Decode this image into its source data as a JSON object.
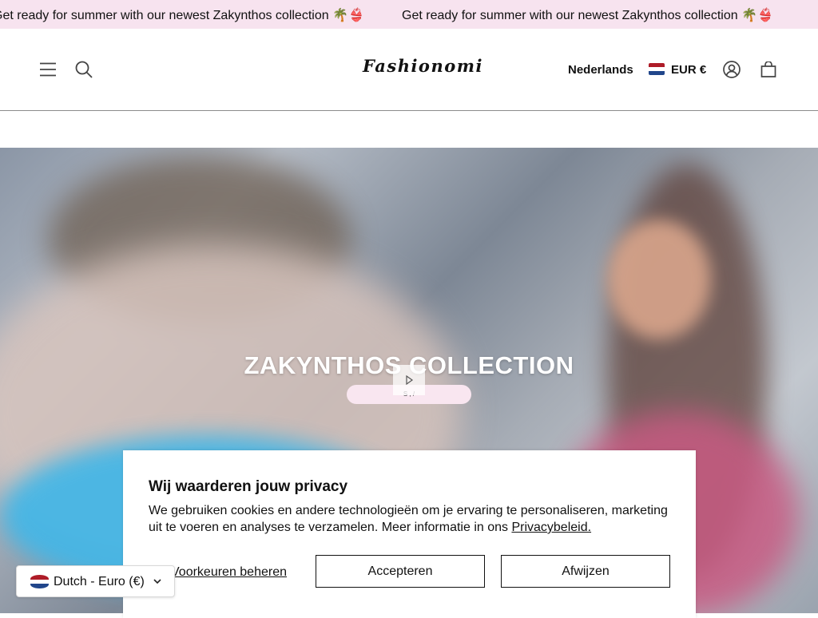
{
  "announcement": {
    "text_1": "Get ready for summer with our newest Zakynthos collection 🌴👙",
    "text_2": "Get ready for summer with our newest Zakynthos collection 🌴👙"
  },
  "header": {
    "logo": "Fashionomi",
    "language": "Nederlands",
    "currency": "EUR €",
    "icons": [
      "menu-icon",
      "search-icon",
      "account-icon",
      "cart-icon"
    ]
  },
  "hero": {
    "title": "ZAKYNTHOS COLLECTION",
    "button_label": "S   ,   /"
  },
  "cookie": {
    "title": "Wij waarderen jouw privacy",
    "text": "We gebruiken cookies en andere technologieën om je ervaring te personaliseren, marketing uit te voeren en analyses te verzamelen. Meer informatie in ons ",
    "link": "Privacybeleid.",
    "manage": "Voorkeuren beheren",
    "accept": "Accepteren",
    "reject": "Afwijzen"
  },
  "selector": {
    "label": "Dutch - Euro (€)"
  },
  "colors": {
    "announcement_bg": "#f7e3ef",
    "flag_red": "#ae1c28",
    "flag_white": "#ffffff",
    "flag_blue": "#21468b"
  }
}
